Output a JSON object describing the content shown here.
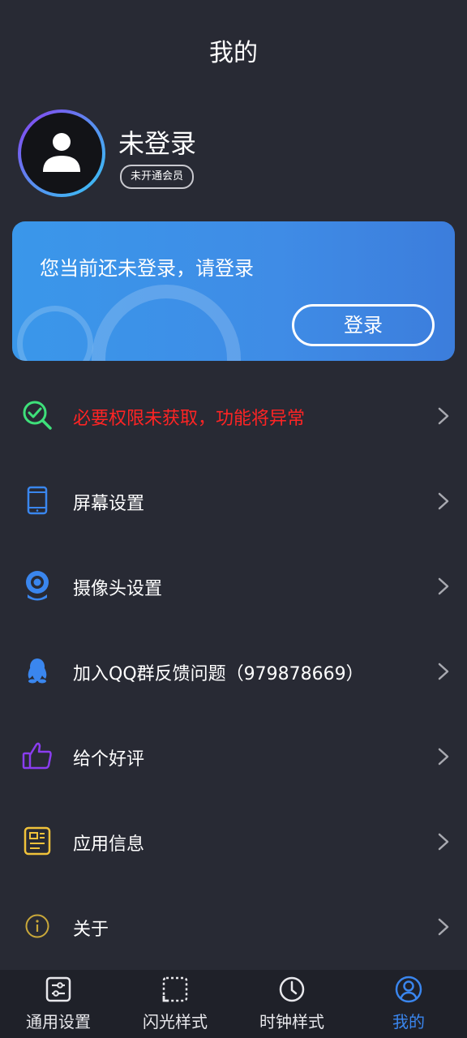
{
  "header": {
    "title": "我的"
  },
  "profile": {
    "username": "未登录",
    "vip_status": "未开通会员"
  },
  "login_card": {
    "message": "您当前还未登录，请登录",
    "button_label": "登录"
  },
  "menu": {
    "items": [
      {
        "label": "必要权限未获取，功能将异常",
        "icon": "permission-check-icon",
        "color": "#ff2424"
      },
      {
        "label": "屏幕设置",
        "icon": "phone-screen-icon"
      },
      {
        "label": "摄像头设置",
        "icon": "camera-icon"
      },
      {
        "label": "加入QQ群反馈问题（979878669）",
        "icon": "qq-penguin-icon"
      },
      {
        "label": "给个好评",
        "icon": "thumbs-up-icon"
      },
      {
        "label": "应用信息",
        "icon": "app-info-icon"
      },
      {
        "label": "关于",
        "icon": "info-icon"
      }
    ]
  },
  "tabbar": {
    "tabs": [
      {
        "label": "通用设置",
        "icon": "sliders-icon"
      },
      {
        "label": "闪光样式",
        "icon": "flash-frame-icon"
      },
      {
        "label": "时钟样式",
        "icon": "clock-icon"
      },
      {
        "label": "我的",
        "icon": "user-circle-icon",
        "active": true
      }
    ]
  },
  "colors": {
    "background": "#282a34",
    "card_blue": "#3a8ee8",
    "accent": "#3a86ee",
    "warning": "#ff2424"
  }
}
